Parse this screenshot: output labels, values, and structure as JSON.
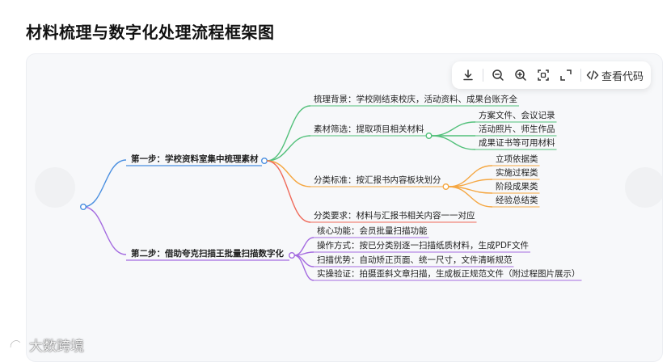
{
  "title": "材料梳理与数字化处理流程框架图",
  "toolbar": {
    "download_icon": "download-icon",
    "zoom_out_icon": "zoom-out-icon",
    "zoom_in_icon": "zoom-in-icon",
    "fit_icon": "fit-screen-icon",
    "fullscreen_icon": "fullscreen-icon",
    "view_code_label": "查看代码"
  },
  "mindmap": {
    "root": "",
    "steps": [
      {
        "label": "第一步：学校资料室集中梳理素材",
        "color": "#4a8fe0",
        "children": [
          {
            "label": "梳理背景：学校刚结束校庆，活动资料、成果台账齐全",
            "color": "#52c07a",
            "children": []
          },
          {
            "label": "素材筛选：提取项目相关材料",
            "color": "#52c07a",
            "children": [
              "方案文件、会议记录",
              "活动照片、师生作品",
              "成果证书等可用材料"
            ]
          },
          {
            "label": "分类标准：按汇报书内容板块划分",
            "color": "#f5a742",
            "children": [
              "立项依据类",
              "实施过程类",
              "阶段成果类",
              "经验总结类"
            ]
          },
          {
            "label": "分类要求：材料与汇报书相关内容一一对应",
            "color": "#ef6a5a",
            "children": []
          }
        ]
      },
      {
        "label": "第二步：借助夸克扫描王批量扫描数字化",
        "color": "#a46be0",
        "children": [
          {
            "label": "核心功能：会员批量扫描功能",
            "color": "#a46be0",
            "children": []
          },
          {
            "label": "操作方式：按已分类别逐一扫描纸质材料，生成PDF文件",
            "color": "#a46be0",
            "children": []
          },
          {
            "label": "扫描优势：自动矫正页面、统一尺寸，文件清晰规范",
            "color": "#a46be0",
            "children": []
          },
          {
            "label": "实操验证：拍摄歪斜文章扫描，生成板正规范文件（附过程图片展示）",
            "color": "#a46be0",
            "children": []
          }
        ]
      }
    ]
  },
  "watermark": {
    "logo_icon": "eye-logo-icon",
    "text": "大数跨境"
  }
}
